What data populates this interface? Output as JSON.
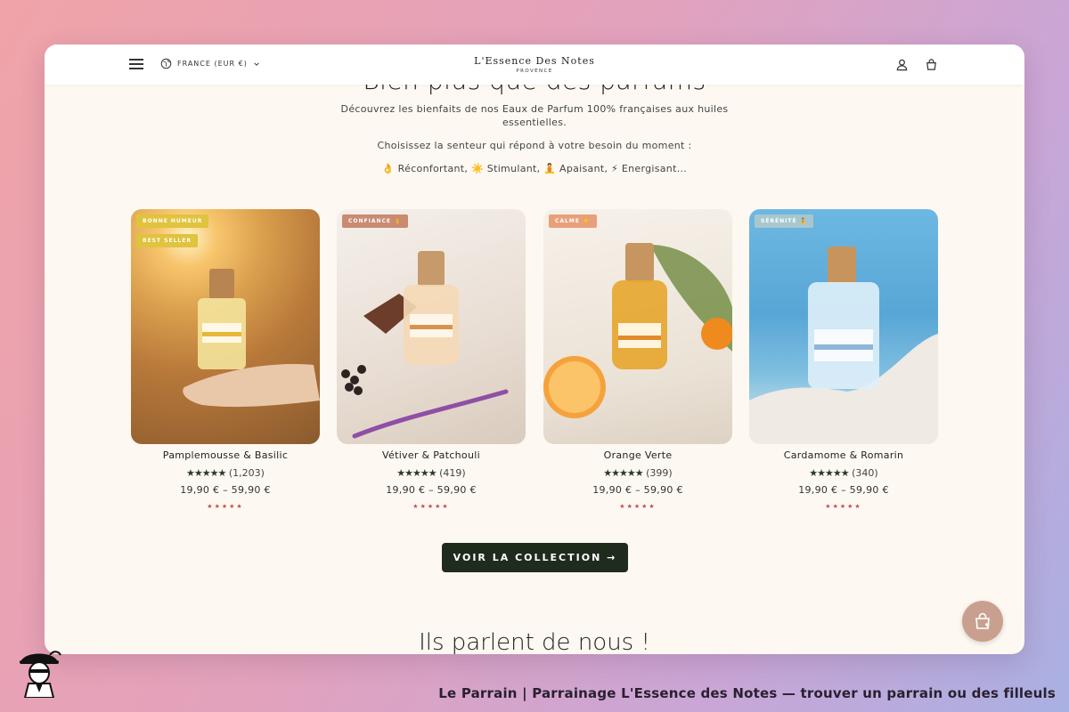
{
  "header": {
    "country": "FRANCE (EUR €)",
    "logo_main": "L'Essence Des Notes",
    "logo_sub": "PROVENCE",
    "icons": [
      "menu-icon",
      "globe-icon",
      "chevron-down-icon",
      "account-icon",
      "cart-icon"
    ]
  },
  "section": {
    "title_partial": "Bien plus que des parfums",
    "intro": "Découvrez les bienfaits de nos Eaux de Parfum 100% françaises aux huiles essentielles.",
    "intro2": "Choisissez la senteur qui répond à votre besoin du moment :",
    "moods": "👌 Réconfortant, ☀️ Stimulant, 🧘 Apaisant, ⚡ Energisant..."
  },
  "products": [
    {
      "name": "Pamplemousse & Basilic",
      "badges": [
        "BONNE HUMEUR",
        "BEST SELLER"
      ],
      "reviews": "(1,203)",
      "price": "19,90 € – 59,90 €",
      "bottle_label": "Pamplemousse & Basilic",
      "badge_colors": [
        "#e0c33e",
        "#e0c33e"
      ]
    },
    {
      "name": "Vétiver & Patchouli",
      "badges": [
        "CONFIANCE 👌"
      ],
      "reviews": "(419)",
      "price": "19,90 € – 59,90 €",
      "bottle_label": "Vétiver & Patchouli",
      "badge_colors": [
        "#c98b72"
      ]
    },
    {
      "name": "Orange Verte",
      "badges": [
        "CALME ☀️"
      ],
      "reviews": "(399)",
      "price": "19,90 € – 59,90 €",
      "bottle_label": "Orange Verte",
      "badge_colors": [
        "#e8a07a"
      ]
    },
    {
      "name": "Cardamome & Romarin",
      "badges": [
        "SÉRÉNITÉ 🧘"
      ],
      "reviews": "(340)",
      "price": "19,90 € – 59,90 €",
      "bottle_label": "Cardamome & Romarin",
      "badge_colors": [
        "#a7c7cf"
      ]
    }
  ],
  "rating_stars": "★★★★★",
  "mini_stars": "★★★★★",
  "cta": "VOIR LA COLLECTION →",
  "testimonials_title": "Ils parlent de nous !",
  "caption": "Le Parrain | Parrainage L'Essence des Notes — trouver un parrain ou des filleuls"
}
